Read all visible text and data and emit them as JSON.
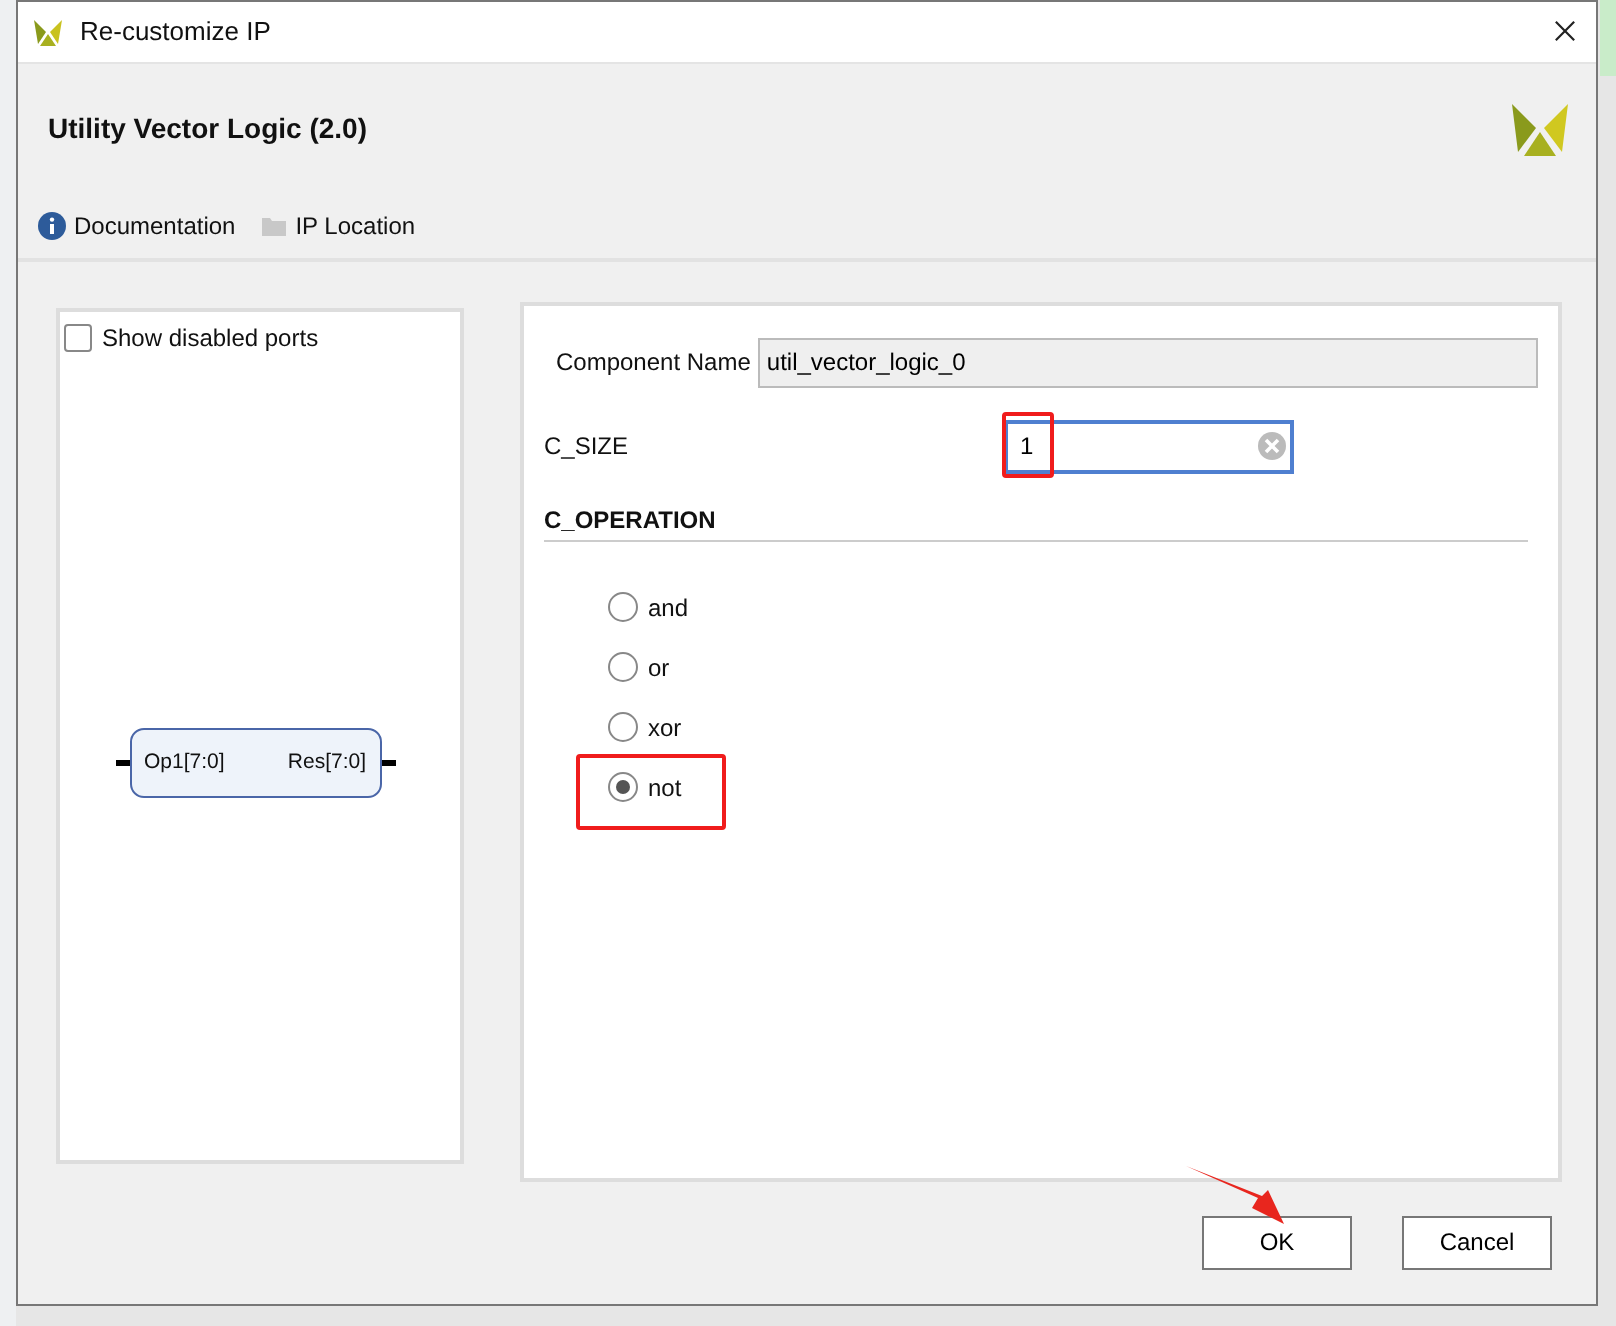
{
  "window": {
    "title": "Re-customize IP"
  },
  "header": {
    "title": "Utility Vector Logic (2.0)"
  },
  "toolbar": [
    {
      "label": "Documentation",
      "kind": "info"
    },
    {
      "label": "IP Location",
      "kind": "folder"
    }
  ],
  "symbol_panel": {
    "show_disabled_ports": {
      "label": "Show disabled ports",
      "checked": false
    },
    "block": {
      "input_port": "Op1[7:0]",
      "output_port": "Res[7:0]"
    }
  },
  "config": {
    "component_name": {
      "label": "Component Name",
      "value": "util_vector_logic_0"
    },
    "c_size": {
      "label": "C_SIZE",
      "value": "1"
    },
    "c_operation": {
      "title": "C_OPERATION",
      "options": [
        {
          "label": "and",
          "selected": false
        },
        {
          "label": "or",
          "selected": false
        },
        {
          "label": "xor",
          "selected": false
        },
        {
          "label": "not",
          "selected": true
        }
      ]
    }
  },
  "buttons": [
    "OK",
    "Cancel"
  ]
}
